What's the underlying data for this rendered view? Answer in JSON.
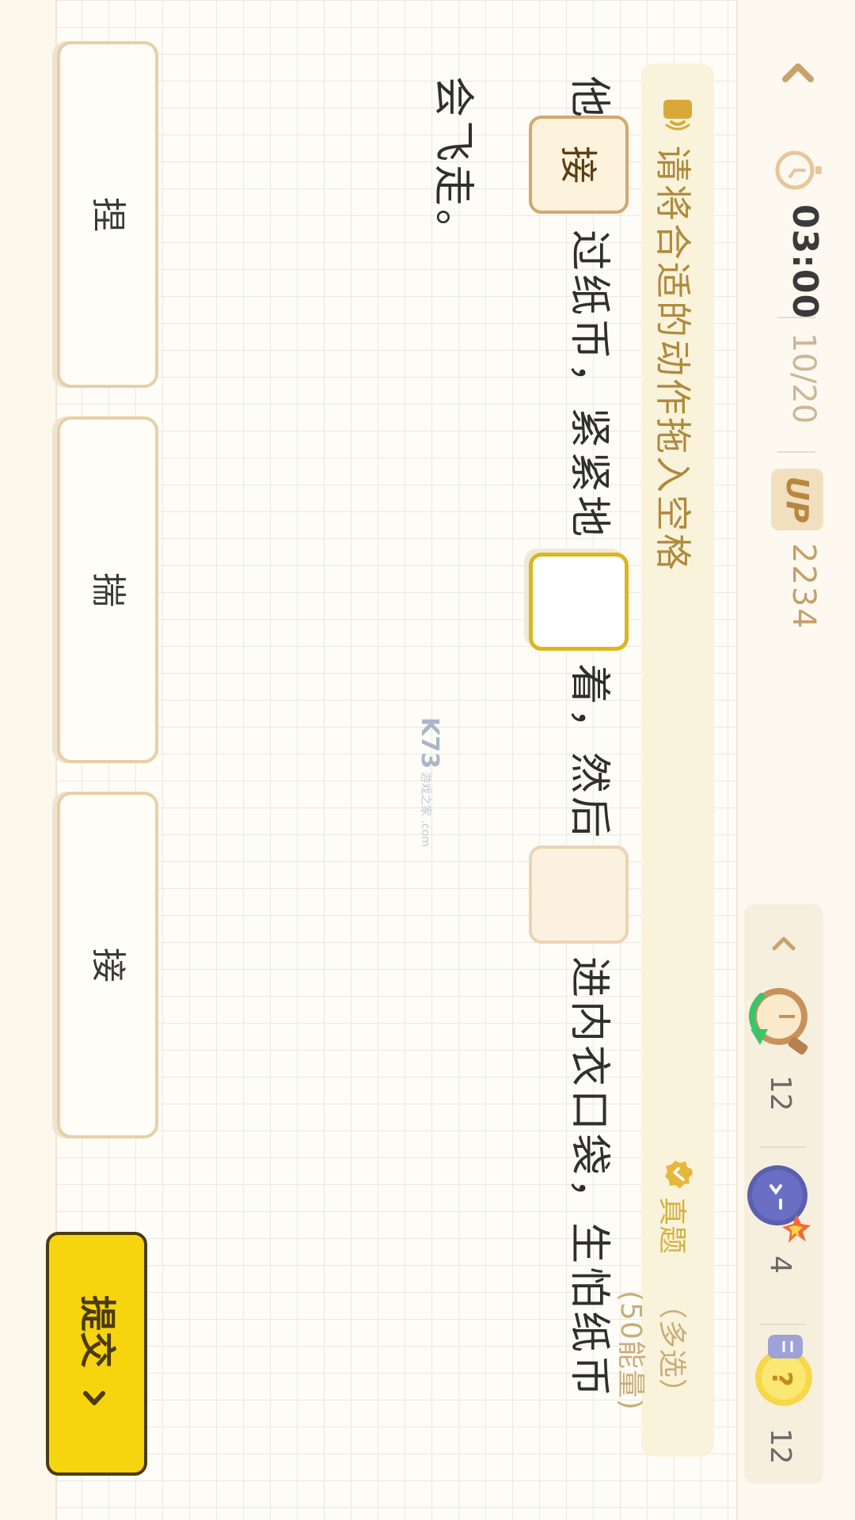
{
  "header": {
    "timer": "03:00",
    "progress": "10/20",
    "up_badge": "UP",
    "up_score": "2234"
  },
  "tools": [
    {
      "name": "time-rewind-icon",
      "count": "12"
    },
    {
      "name": "bomb-icon",
      "count": "4"
    },
    {
      "name": "hint-bulb-icon",
      "count": "12"
    }
  ],
  "instruction": {
    "text": "请将合适的动作拖入空格",
    "tag": "真题",
    "meta": "（多选）(50能量)"
  },
  "sentence": {
    "line1": {
      "part1": "他",
      "blank1": "接",
      "part2": "过纸币，紧紧地",
      "blank2": "",
      "part3": "着，然后",
      "blank3": "",
      "part4": "进内衣口袋，生怕纸币"
    },
    "line2": "会飞走。"
  },
  "choices": [
    "捏",
    "揣",
    "接"
  ],
  "submit_label": "提交",
  "watermark": {
    "main": "K73",
    "sub": "游戏之家 .com"
  },
  "colors": {
    "accent": "#f7d50e",
    "instruction_text": "#b08a3c",
    "slot_border": "#d2a870",
    "active_slot": "#dcb620"
  }
}
